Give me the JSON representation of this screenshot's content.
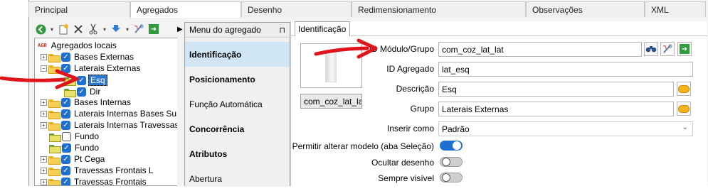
{
  "tabs": [
    {
      "label": "Principal",
      "active": false
    },
    {
      "label": "Agregados",
      "active": true
    },
    {
      "label": "Desenho",
      "active": false
    },
    {
      "label": "Redimensionamento",
      "active": false
    },
    {
      "label": "Observações",
      "active": false
    },
    {
      "label": "XML",
      "active": false
    }
  ],
  "toolbar": {
    "icons": [
      "back-arrow-icon",
      "new-item-icon",
      "delete-icon",
      "cut-icon",
      "move-down-icon",
      "tools-icon",
      "export-icon"
    ]
  },
  "tree": {
    "root_badge": "AGR",
    "root_label": "Agregados locais",
    "items": [
      {
        "label": "Bases Externas",
        "checked": true
      },
      {
        "label": "Laterais Externas",
        "checked": true
      },
      {
        "label": "Esq",
        "checked": true,
        "selected": true
      },
      {
        "label": "Dir",
        "checked": true
      },
      {
        "label": "Bases Internas",
        "checked": true
      },
      {
        "label": "Laterais Internas Bases Sup",
        "checked": true
      },
      {
        "label": "Laterais Internas Travessas",
        "checked": true
      },
      {
        "label": "Fundo",
        "checked": false
      },
      {
        "label": "Fundo",
        "checked": true
      },
      {
        "label": "Pt Cega",
        "checked": true
      },
      {
        "label": "Travessas Frontais L",
        "checked": true
      },
      {
        "label": "Travessas Frontais",
        "checked": true
      }
    ]
  },
  "menu": {
    "title": "Menu do agregado",
    "pin_icon": "pin-icon",
    "items": [
      {
        "label": "Identificação",
        "bold": true,
        "active": true
      },
      {
        "label": "Posicionamento",
        "bold": true,
        "active": false
      },
      {
        "label": "Função Automática",
        "bold": false,
        "active": false
      },
      {
        "label": "Concorrência",
        "bold": true,
        "active": false
      },
      {
        "label": "Atributos",
        "bold": true,
        "active": false
      },
      {
        "label": "Abertura",
        "bold": false,
        "active": false
      }
    ]
  },
  "panel": {
    "tab": "Identificação",
    "thumbnail_name": "com_coz_lat_lat",
    "fields": {
      "id_modulo_label": "ID Módulo/Grupo",
      "id_modulo_value": "com_coz_lat_lat",
      "id_agregado_label": "ID Agregado",
      "id_agregado_value": "lat_esq",
      "descricao_label": "Descrição",
      "descricao_value": "Esq",
      "grupo_label": "Grupo",
      "grupo_value": "Laterais Externas",
      "inserir_label": "Inserir como",
      "inserir_value": "Padrão"
    },
    "toggles": [
      {
        "label": "Permitir alterar modelo (aba Seleção)",
        "on": true
      },
      {
        "label": "Ocultar desenho",
        "on": false
      },
      {
        "label": "Sempre visível",
        "on": false
      }
    ]
  },
  "colors": {
    "accent": "#1f6fd1",
    "annotation_arrow": "#e0141b",
    "menu_active": "#d0e6f5"
  }
}
